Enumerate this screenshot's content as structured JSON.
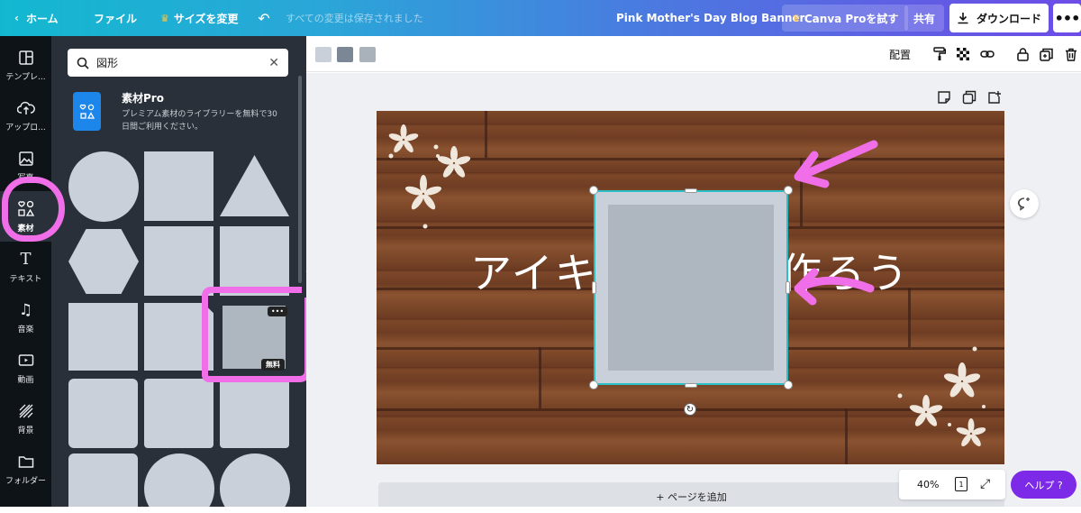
{
  "topbar": {
    "home_label": "ホーム",
    "file_label": "ファイル",
    "resize_label": "サイズを変更",
    "saved_status": "すべての変更は保存されました",
    "document_title": "Pink Mother's Day Blog Banner",
    "pro_label": "Canva Proを試す",
    "share_label": "共有",
    "download_label": "ダウンロード"
  },
  "rail": {
    "items": [
      {
        "label": "テンプレ...",
        "icon": "template-icon"
      },
      {
        "label": "アップロ...",
        "icon": "upload-icon"
      },
      {
        "label": "写真",
        "icon": "photo-icon"
      },
      {
        "label": "素材",
        "icon": "elements-icon"
      },
      {
        "label": "テキスト",
        "icon": "text-icon"
      },
      {
        "label": "音楽",
        "icon": "music-icon"
      },
      {
        "label": "動画",
        "icon": "video-icon"
      },
      {
        "label": "背景",
        "icon": "background-icon"
      },
      {
        "label": "フォルダー",
        "icon": "folder-icon"
      }
    ]
  },
  "panel": {
    "search_value": "図形",
    "pro_title": "素材Pro",
    "pro_desc": "プレミアム素材のライブラリーを無料で30日間ご利用ください。",
    "free_badge": "無料",
    "more_label": "•••"
  },
  "context_toolbar": {
    "swatches": [
      "#c9d0da",
      "#7b8794",
      "#a9b1bb"
    ],
    "arrange_label": "配置"
  },
  "canvas": {
    "headline_left": "アイキ",
    "headline_right": "作ろう",
    "add_page_label": "+ ページを追加"
  },
  "bottom": {
    "zoom": "40%",
    "page_count": "1",
    "help_label": "ヘルプ ?"
  },
  "colors": {
    "highlight_pink": "#f06ee8",
    "selection_teal": "#2bc0c7",
    "help_purple": "#7d2ae8"
  }
}
